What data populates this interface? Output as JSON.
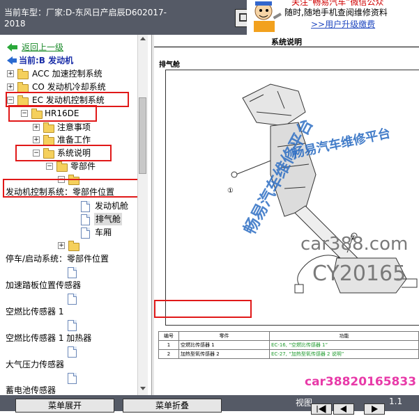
{
  "header": {
    "vehicle_label": "当前车型：厂家:D-东风日产启辰D602017-2018"
  },
  "ad": {
    "line1": "关注“畅易汽车”微信公众",
    "line2": "随时,随地手机查阅维修资料",
    "link": ">>用户升级缴费"
  },
  "tree": {
    "back": "返回上一级",
    "current": "当前:B 发动机",
    "acc": "ACC 加速控制系统",
    "co": "CO 发动机冷却系统",
    "ec": "EC 发动机控制系统",
    "hr16de": "HR16DE",
    "notes": "注意事项",
    "prep": "准备工作",
    "sysdesc": "系统说明",
    "parts": "零部件",
    "parts_location": "发动机控制系统：零部件位置",
    "engine_bay": "发动机舱",
    "exhaust": "排气舱",
    "cabin": "车厢",
    "stopstart": "停车/启动系统：零部件位置",
    "pedal": "加速踏板位置传感器",
    "af1": "空燃比传感器 1",
    "af1_heater": "空燃比传感器 1 加热器",
    "baro": "大气压力传感器",
    "battery": "蓄电池传感器"
  },
  "document": {
    "title": "系统说明",
    "section": "排气舱",
    "callout1": "①",
    "callout2": "②",
    "table": {
      "headers": [
        "编号",
        "零件",
        "功能"
      ],
      "rows": [
        [
          "1",
          "空燃比传感器 1",
          "EC-16, “空燃比传感器 1”"
        ],
        [
          "2",
          "加热型氧传感器 2",
          "EC-27, “加热型氧传感器 2 说明”"
        ]
      ]
    }
  },
  "watermarks": {
    "platform1": "畅易汽车维修平台",
    "platform2": "畅易汽车维修平台",
    "site": "car388.com",
    "code": "CY20165",
    "bottom": "car38820165833"
  },
  "toolbar": {
    "expand": "菜单展开",
    "collapse": "菜单折叠",
    "view": "视图",
    "page": "1.1"
  },
  "colors": {
    "header_bg": "#555a66",
    "highlight_red": "#e01818",
    "link_green": "#1d9a2c",
    "watermark_blue": "#2f6fc4"
  }
}
